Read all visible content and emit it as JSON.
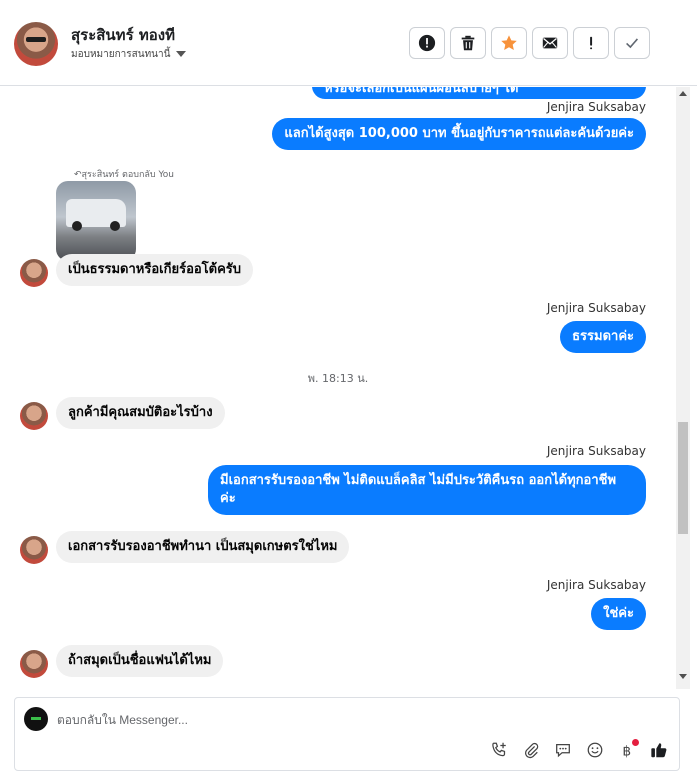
{
  "header": {
    "contact_name": "สุระสินทร์ ทองที",
    "assign_label": "มอบหมายการสนทนานี้",
    "toolbar": [
      {
        "name": "report-button",
        "icon": "alert-circle-icon"
      },
      {
        "name": "delete-button",
        "icon": "trash-icon"
      },
      {
        "name": "star-button",
        "icon": "star-icon"
      },
      {
        "name": "mark-unread-button",
        "icon": "envelope-icon"
      },
      {
        "name": "follow-up-button",
        "icon": "exclamation-icon"
      },
      {
        "name": "done-button",
        "icon": "checkmark-icon"
      }
    ]
  },
  "thread": {
    "partial_top_message": "หรือจะเลือกเป็นแผนผ่อนสบายๆ ได้",
    "sender_name": "Jenjira Suksabay",
    "msg_1": "แลกได้สูงสุด 100,000 บาท ขึ้นอยู่กับราคารถแต่ละคันด้วยค่ะ",
    "reply_note": "สุระสินทร์ ตอบกลับ You",
    "msg_2": "เป็นธรรมดาหรือเกียร์ออโต้ครับ",
    "msg_3": "ธรรมดาค่ะ",
    "timestamp": "พ. 18:13 น.",
    "msg_4": "ลูกค้ามีคุณสมบัติอะไรบ้าง",
    "msg_5_line1": "มีเอกสารรับรองอาชีพ ไม่ติดแบล็คลิส ไม่มีประวัติคืนรถ ออกได้ทุกอาชีพ",
    "msg_5_line2": "ค่ะ",
    "msg_6": "เอกสารรับรองอาชีพทำนา เป็นสมุดเกษตรใช่ไหม",
    "msg_7": "ใช่ค่ะ",
    "msg_8": "ถ้าสมุดเป็นชื่อแฟนได้ไหม"
  },
  "composer": {
    "placeholder": "ตอบกลับใน Messenger...",
    "icons": [
      "phone-add-icon",
      "attachment-icon",
      "saved-reply-icon",
      "emoji-icon",
      "baht-payment-icon",
      "thumbs-up-icon"
    ]
  },
  "colors": {
    "outgoing_bubble": "#0a7cff",
    "incoming_bubble": "#f0f0f0",
    "star_accent": "#f7923b"
  }
}
